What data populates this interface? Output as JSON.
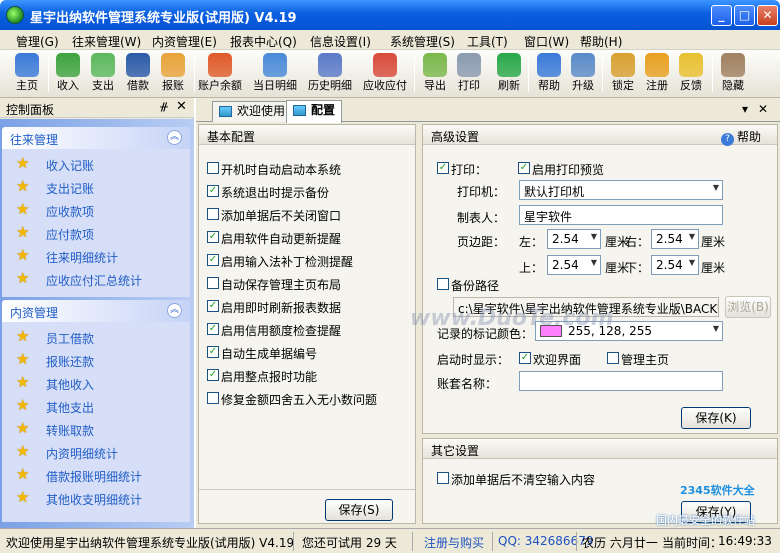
{
  "window": {
    "title": "星宇出纳软件管理系统专业版(试用版) V4.19"
  },
  "menu": [
    "管理(G)",
    "往来管理(W)",
    "内资管理(E)",
    "报表中心(Q)",
    "信息设置(I)",
    "系统管理(S)",
    "工具(T)",
    "窗口(W)",
    "帮助(H)"
  ],
  "toolbar": [
    {
      "label": "主页",
      "icon": "home-icon",
      "color": "#3b7ad8"
    },
    {
      "label": "收入",
      "icon": "income-icon",
      "color": "#3da33d"
    },
    {
      "label": "支出",
      "icon": "expense-icon",
      "color": "#5cb85c"
    },
    {
      "label": "借款",
      "icon": "borrow-icon",
      "color": "#2a5aa8"
    },
    {
      "label": "报账",
      "icon": "reimburse-icon",
      "color": "#e8a33a"
    },
    {
      "label": "账户余额",
      "icon": "balance-icon",
      "color": "#e05a2a"
    },
    {
      "label": "当日明细",
      "icon": "calendar-icon",
      "color": "#4a8ad8"
    },
    {
      "label": "历史明细",
      "icon": "history-icon",
      "color": "#5a7ac8"
    },
    {
      "label": "应收应付",
      "icon": "receivable-icon",
      "color": "#d84a3a"
    },
    {
      "label": "导出",
      "icon": "export-icon",
      "color": "#7ab84a"
    },
    {
      "label": "打印",
      "icon": "print-icon",
      "color": "#8a9ab0"
    },
    {
      "label": "刷新",
      "icon": "refresh-icon",
      "color": "#2aa84a"
    },
    {
      "label": "帮助",
      "icon": "help-icon",
      "color": "#3a7ad8"
    },
    {
      "label": "升级",
      "icon": "upgrade-icon",
      "color": "#5a8ac8"
    },
    {
      "label": "锁定",
      "icon": "lock-icon",
      "color": "#d8a030"
    },
    {
      "label": "注册",
      "icon": "register-icon",
      "color": "#e8a020"
    },
    {
      "label": "反馈",
      "icon": "feedback-icon",
      "color": "#e8c030"
    },
    {
      "label": "隐藏",
      "icon": "hide-icon",
      "color": "#a08060"
    }
  ],
  "left_panel": {
    "title": "控制面板",
    "groups": [
      {
        "title": "往来管理",
        "items": [
          "收入记账",
          "支出记账",
          "应收款项",
          "应付款项",
          "往来明细统计",
          "应收应付汇总统计"
        ]
      },
      {
        "title": "内资管理",
        "items": [
          "员工借款",
          "报账还款",
          "其他收入",
          "其他支出",
          "转账取款",
          "内资明细统计",
          "借款报账明细统计",
          "其他收支明细统计"
        ]
      }
    ]
  },
  "tabs": [
    {
      "label": "欢迎使用",
      "active": false
    },
    {
      "label": "配置",
      "active": true
    }
  ],
  "basic": {
    "title": "基本配置",
    "options": [
      {
        "label": "开机时自动启动本系统",
        "checked": false
      },
      {
        "label": "系统退出时提示备份",
        "checked": true
      },
      {
        "label": "添加单据后不关闭窗口",
        "checked": false
      },
      {
        "label": "启用软件自动更新提醒",
        "checked": true
      },
      {
        "label": "启用输入法补丁检测提醒",
        "checked": true
      },
      {
        "label": "自动保存管理主页布局",
        "checked": false
      },
      {
        "label": "启用即时刷新报表数据",
        "checked": true
      },
      {
        "label": "启用信用额度检查提醒",
        "checked": true
      },
      {
        "label": "自动生成单据编号",
        "checked": true
      },
      {
        "label": "启用整点报时功能",
        "checked": true
      },
      {
        "label": "修复金额四舍五入无小数问题",
        "checked": false
      }
    ],
    "save": "保存(S)"
  },
  "advanced": {
    "title": "高级设置",
    "help": "帮助",
    "print_label": "打印：",
    "print_checked": true,
    "preview_label": "启用打印预览",
    "preview_checked": true,
    "printer_label": "打印机：",
    "printer_value": "默认打印机",
    "maker_label": "制表人：",
    "maker_value": "星宇软件",
    "margin_label": "页边距：",
    "left_label": "左：",
    "left_value": "2.54",
    "right_label": "右：",
    "right_value": "2.54",
    "top_label": "上：",
    "top_value": "2.54",
    "bottom_label": "下：",
    "bottom_value": "2.54",
    "unit": "厘米",
    "backup_label": "备份路径",
    "backup_value": "c:\\星宇软件\\星宇出纳软件管理系统专业版\\BACKUP",
    "browse": "浏览(B)",
    "color_label": "记录的标记颜色：",
    "color_value": "255, 128, 255",
    "color_swatch": "#ff80ff",
    "startup_label": "启动时显示：",
    "welcome_label": "欢迎界面",
    "welcome_checked": true,
    "home_label": "管理主页",
    "home_checked": false,
    "account_label": "账套名称：",
    "account_value": "",
    "save": "保存(K)"
  },
  "other": {
    "title": "其它设置",
    "option": "添加单据后不清空输入内容",
    "checked": false,
    "save": "保存(Y)"
  },
  "status": {
    "welcome": "欢迎使用星宇出纳软件管理系统专业版(试用版) V4.19",
    "trial": "您还可试用 29 天",
    "register": "注册与购买",
    "qq": "QQ: 342686679",
    "lunar": "农历 六月廿一",
    "time_label": "当前时间：",
    "time": "16:49:33"
  },
  "watermark": "www.DuoTe.com",
  "badge": {
    "brand": "2345软件大全",
    "slogan": "国内最安全的软件站"
  }
}
